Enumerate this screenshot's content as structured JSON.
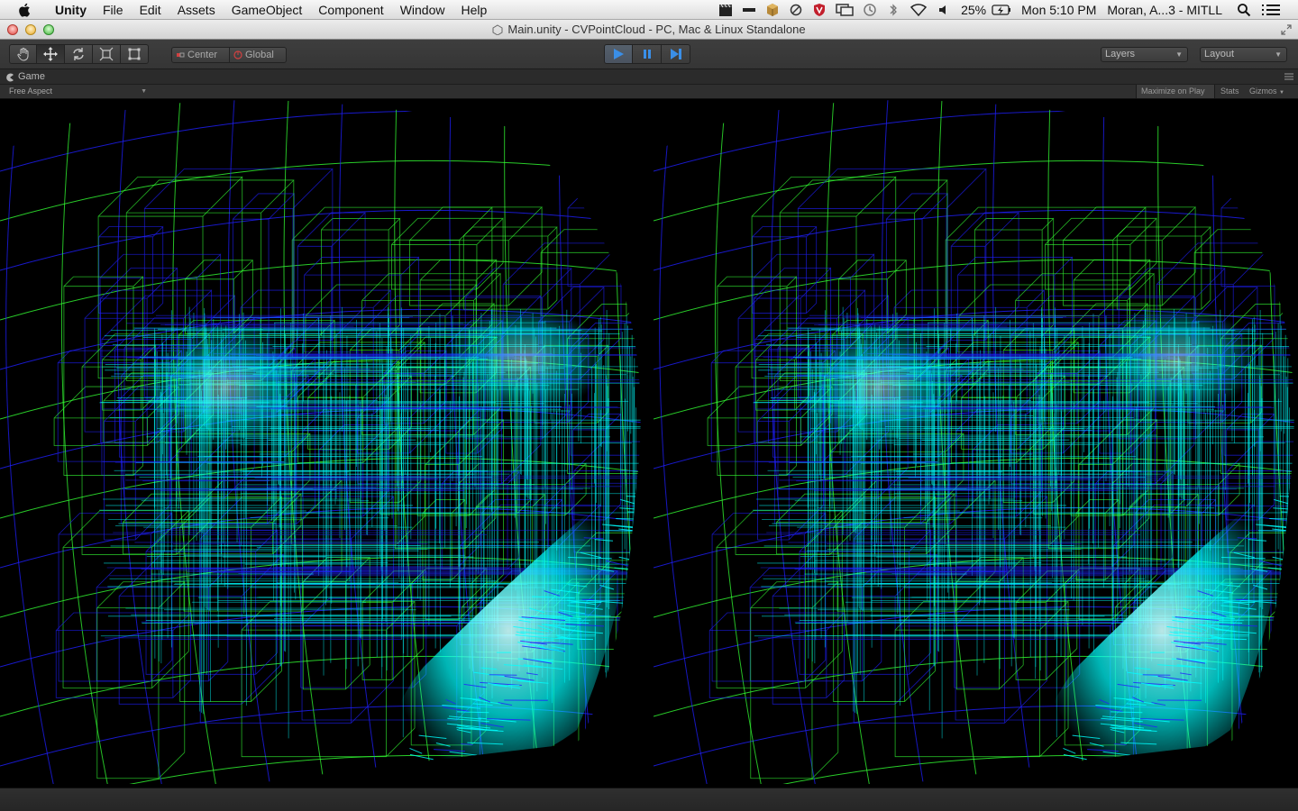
{
  "menubar": {
    "app_name": "Unity",
    "items": [
      "File",
      "Edit",
      "Assets",
      "GameObject",
      "Component",
      "Window",
      "Help"
    ],
    "battery_percent": "25%",
    "clock": "Mon 5:10 PM",
    "user": "Moran, A...3 - MITLL"
  },
  "window": {
    "title": "Main.unity - CVPointCloud - PC, Mac & Linux Standalone"
  },
  "toolbar": {
    "pivot_label": "Center",
    "rotation_label": "Global",
    "layers_label": "Layers",
    "layout_label": "Layout"
  },
  "game_view": {
    "tab_label": "Game",
    "aspect_label": "Free Aspect",
    "maximize_label": "Maximize on Play",
    "stats_label": "Stats",
    "gizmos_label": "Gizmos"
  },
  "colors": {
    "point_cloud_cyan": "#00ffff",
    "grid_green": "#33ff33",
    "grid_blue": "#1f1fff",
    "play_accent": "#3a8fe8"
  }
}
